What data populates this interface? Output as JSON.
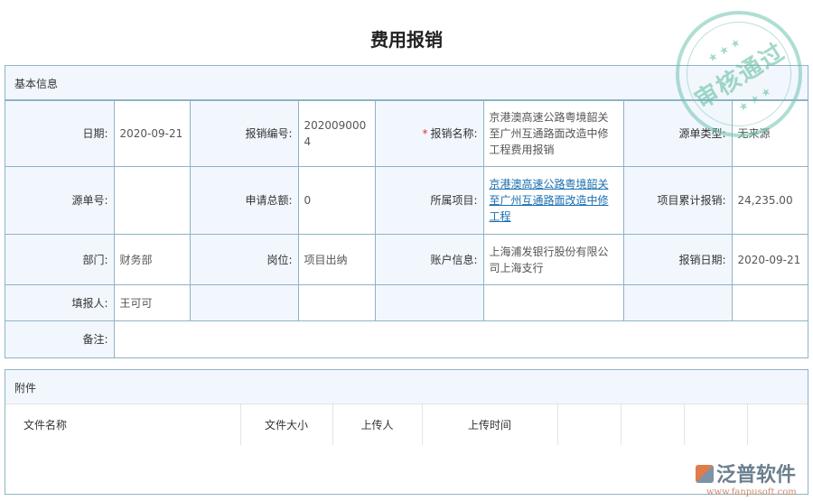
{
  "page_title": "费用报销",
  "basic": {
    "section_title": "基本信息",
    "rows": [
      [
        {
          "label": "日期:",
          "value": "2020-09-21"
        },
        {
          "label": "报销编号:",
          "value": "2020090004"
        },
        {
          "label": "报销名称:",
          "value": "京港澳高速公路粤境韶关至广州互通路面改造中修工程费用报销",
          "required": true
        },
        {
          "label": "源单类型:",
          "value": "无来源"
        }
      ],
      [
        {
          "label": "源单号:",
          "value": ""
        },
        {
          "label": "申请总额:",
          "value": "0"
        },
        {
          "label": "所属项目:",
          "value": "京港澳高速公路粤境韶关至广州互通路面改造中修工程",
          "link": true
        },
        {
          "label": "项目累计报销:",
          "value": "24,235.00"
        }
      ],
      [
        {
          "label": "部门:",
          "value": "财务部"
        },
        {
          "label": "岗位:",
          "value": "项目出纳"
        },
        {
          "label": "账户信息:",
          "value": "上海浦发银行股份有限公司上海支行"
        },
        {
          "label": "报销日期:",
          "value": "2020-09-21"
        }
      ],
      [
        {
          "label": "填报人:",
          "value": "王可可"
        }
      ]
    ],
    "remark_label": "备注:",
    "remark_value": ""
  },
  "attachments": {
    "section_title": "附件",
    "columns": [
      "文件名称",
      "文件大小",
      "上传人",
      "上传时间",
      "",
      "",
      "",
      ""
    ]
  },
  "stamp": {
    "text": "审核通过",
    "color": "#6ec3af"
  },
  "logo": {
    "name": "泛普软件",
    "url": "www.fanpusoft.com"
  }
}
